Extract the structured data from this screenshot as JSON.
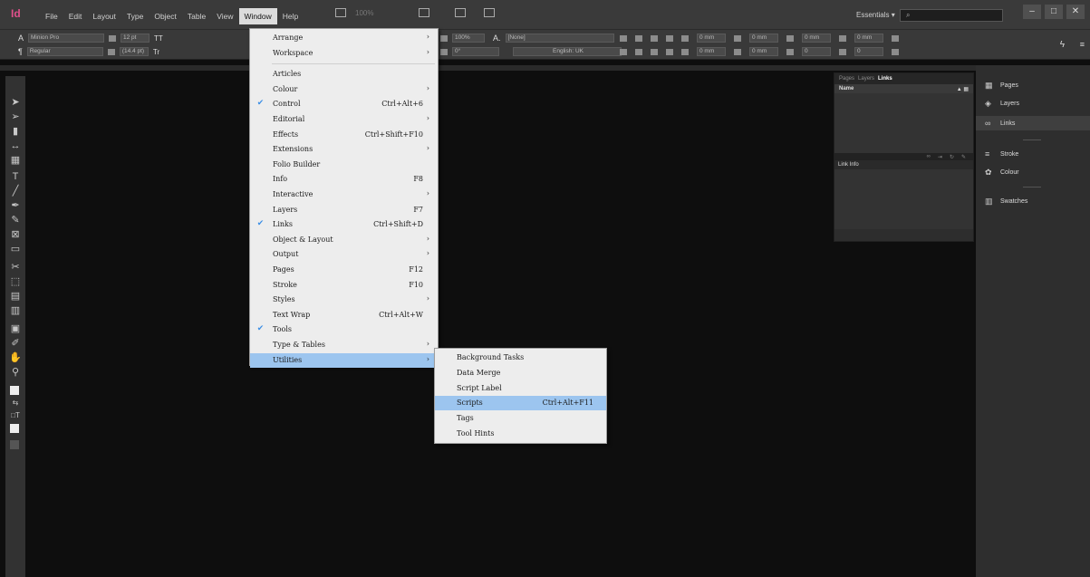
{
  "app": {
    "logo": "Id",
    "menus": [
      "File",
      "Edit",
      "Layout",
      "Type",
      "Object",
      "Table",
      "View",
      "Window",
      "Help"
    ],
    "active_menu": "Window",
    "zoom": "100%",
    "workspace": "Essentials",
    "win_min": "–",
    "win_max": "□",
    "win_close": "✕"
  },
  "control": {
    "row1_label": "A",
    "row2_label": "¶",
    "font_family": "Minion Pro",
    "font_style": "Regular",
    "font_size": "12 pt",
    "leading": "(14.4 pt)",
    "scale": "100%",
    "char_style": "[None]",
    "language": "English: UK",
    "baseline": "0°",
    "ind1": "0 mm",
    "ind2": "0 mm",
    "ind3": "0 mm",
    "ind4": "0 mm",
    "ind5": "0 mm",
    "ind6": "0 mm",
    "sp1": "0",
    "sp2": "0",
    "tt": "TT",
    "tr": "Tr"
  },
  "window_menu": [
    {
      "label": "Arrange",
      "arrow": true
    },
    {
      "label": "Workspace",
      "arrow": true
    },
    {
      "sep": true
    },
    {
      "label": "Articles"
    },
    {
      "label": "Colour",
      "arrow": true
    },
    {
      "label": "Control",
      "checked": true,
      "shortcut": "Ctrl+Alt+6"
    },
    {
      "label": "Editorial",
      "arrow": true
    },
    {
      "label": "Effects",
      "shortcut": "Ctrl+Shift+F10"
    },
    {
      "label": "Extensions",
      "arrow": true
    },
    {
      "label": "Folio Builder"
    },
    {
      "label": "Info",
      "shortcut": "F8"
    },
    {
      "label": "Interactive",
      "arrow": true
    },
    {
      "label": "Layers",
      "shortcut": "F7"
    },
    {
      "label": "Links",
      "checked": true,
      "shortcut": "Ctrl+Shift+D"
    },
    {
      "label": "Object & Layout",
      "arrow": true
    },
    {
      "label": "Output",
      "arrow": true
    },
    {
      "label": "Pages",
      "shortcut": "F12"
    },
    {
      "label": "Stroke",
      "shortcut": "F10"
    },
    {
      "label": "Styles",
      "arrow": true
    },
    {
      "label": "Text Wrap",
      "shortcut": "Ctrl+Alt+W"
    },
    {
      "label": "Tools",
      "checked": true
    },
    {
      "label": "Type & Tables",
      "arrow": true
    },
    {
      "label": "Utilities",
      "arrow": true,
      "highlighted": true
    }
  ],
  "utilities_menu": [
    {
      "label": "Background Tasks"
    },
    {
      "label": "Data Merge"
    },
    {
      "label": "Script Label"
    },
    {
      "label": "Scripts",
      "shortcut": "Ctrl+Alt+F11",
      "highlighted": true
    },
    {
      "label": "Tags"
    },
    {
      "label": "Tool Hints"
    }
  ],
  "links_panel": {
    "tabs": [
      "Pages",
      "Layers",
      "Links"
    ],
    "active_tab": "Links",
    "header_name": "Name",
    "link_info": "Link Info"
  },
  "dock": {
    "items": [
      "Pages",
      "Layers",
      "Links",
      "Stroke",
      "Colour",
      "Swatches"
    ],
    "selected": "Links"
  }
}
